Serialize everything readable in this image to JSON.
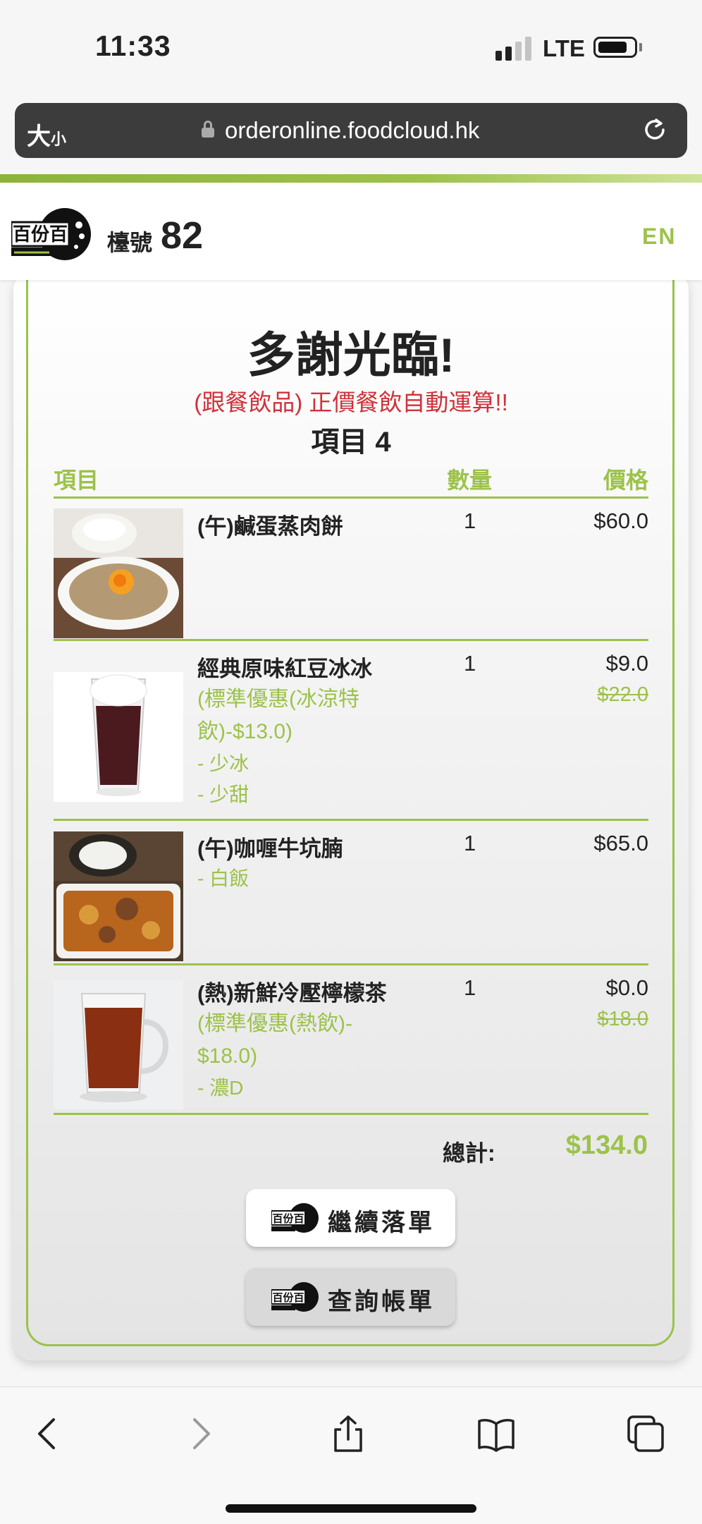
{
  "status_bar": {
    "time": "11:33",
    "network": "LTE"
  },
  "browser": {
    "text_size_label": "大",
    "text_size_small": "小",
    "url": "orderonline.foodcloud.hk"
  },
  "header": {
    "table_label": "檯號",
    "table_number": "82",
    "lang_toggle": "EN",
    "logo_text": "百份百"
  },
  "receipt": {
    "thanks": "多謝光臨!",
    "notice": "(跟餐飲品) 正價餐飲自動運算!!",
    "item_count": "項目 4",
    "columns": {
      "item": "項目",
      "qty": "數量",
      "price": "價格"
    },
    "items": [
      {
        "name": "(午)鹹蛋蒸肉餅",
        "options": [],
        "modifiers": [],
        "qty": "1",
        "price": "$60.0",
        "original_price": ""
      },
      {
        "name": "經典原味紅豆冰冰",
        "options": [
          "(標準優惠(冰涼特",
          "飲)-$13.0)"
        ],
        "modifiers": [
          "- 少冰",
          "- 少甜"
        ],
        "qty": "1",
        "price": "$9.0",
        "original_price": "$22.0"
      },
      {
        "name": "(午)咖喱牛坑腩",
        "options": [],
        "modifiers": [
          "- 白飯"
        ],
        "qty": "1",
        "price": "$65.0",
        "original_price": ""
      },
      {
        "name": "(熱)新鮮冷壓檸檬茶",
        "options": [
          "(標準優惠(熱飲)-",
          "$18.0)"
        ],
        "modifiers": [
          "- 濃D"
        ],
        "qty": "1",
        "price": "$0.0",
        "original_price": "$18.0"
      }
    ],
    "total_label": "總計:",
    "total_value": "$134.0",
    "continue_button": "繼續落單",
    "bill_button": "查詢帳單"
  },
  "colors": {
    "accent": "#9cc24a",
    "notice": "#d0323a",
    "url_bar": "#3c3c3c"
  },
  "bottom_nav": [
    "back-icon",
    "forward-icon",
    "share-icon",
    "bookmarks-icon",
    "tabs-icon"
  ]
}
